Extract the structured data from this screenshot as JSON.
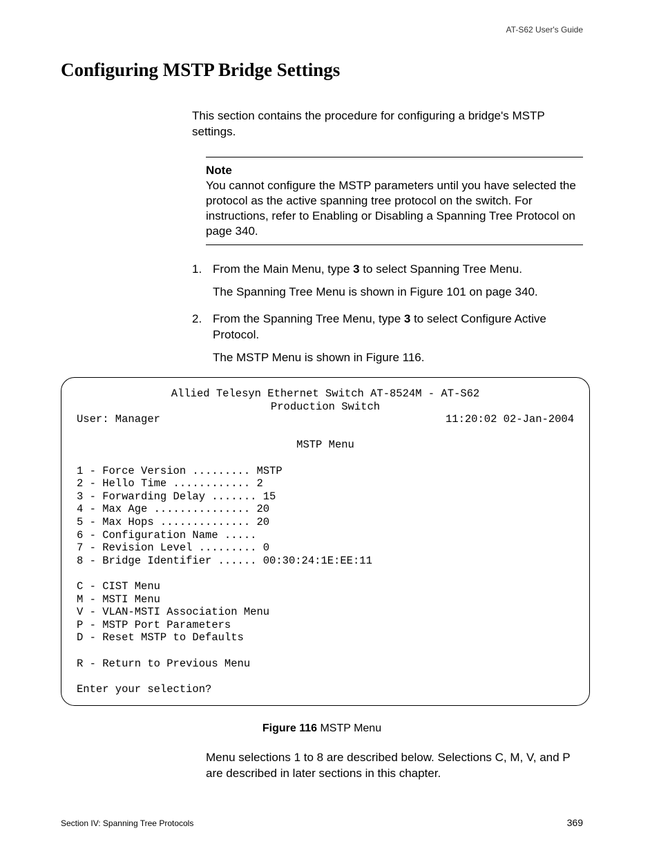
{
  "header": {
    "guide": "AT-S62 User's Guide"
  },
  "title": "Configuring MSTP Bridge Settings",
  "intro": "This section contains the procedure for configuring a bridge's MSTP settings.",
  "note": {
    "label": "Note",
    "text": "You cannot configure the MSTP parameters until you have selected the protocol as the active spanning tree protocol on the switch. For instructions, refer to Enabling or Disabling a Spanning Tree Protocol on page 340."
  },
  "steps": {
    "s1": {
      "num": "1.",
      "pre": "From the Main Menu, type ",
      "key": "3",
      "post": " to select Spanning Tree Menu.",
      "sub": "The Spanning Tree Menu is shown in Figure 101 on page 340."
    },
    "s2": {
      "num": "2.",
      "pre": "From the Spanning Tree Menu, type ",
      "key": "3",
      "post": " to select Configure Active Protocol.",
      "sub": "The MSTP Menu is shown in Figure 116."
    }
  },
  "terminal": {
    "title1": "Allied Telesyn Ethernet Switch AT-8524M - AT-S62",
    "title2": "Production Switch",
    "user": "User: Manager",
    "timestamp": "11:20:02 02-Jan-2004",
    "menu_title": "MSTP Menu",
    "items": {
      "i1": "1 - Force Version ......... MSTP",
      "i2": "2 - Hello Time ............ 2",
      "i3": "3 - Forwarding Delay ....... 15",
      "i4": "4 - Max Age ............... 20",
      "i5": "5 - Max Hops .............. 20",
      "i6": "6 - Configuration Name .....",
      "i7": "7 - Revision Level ......... 0",
      "i8": "8 - Bridge Identifier ...... 00:30:24:1E:EE:11",
      "c": "C - CIST Menu",
      "m": "M - MSTI Menu",
      "v": "V - VLAN-MSTI Association Menu",
      "p": "P - MSTP Port Parameters",
      "d": "D - Reset MSTP to Defaults",
      "r": "R - Return to Previous Menu",
      "prompt": "Enter your selection?"
    }
  },
  "figure": {
    "label": "Figure 116",
    "caption": "  MSTP Menu"
  },
  "after": "Menu selections 1 to 8 are described below. Selections C, M, V, and P are described in later sections in this chapter.",
  "footer": {
    "section": "Section IV: Spanning Tree Protocols",
    "page": "369"
  }
}
